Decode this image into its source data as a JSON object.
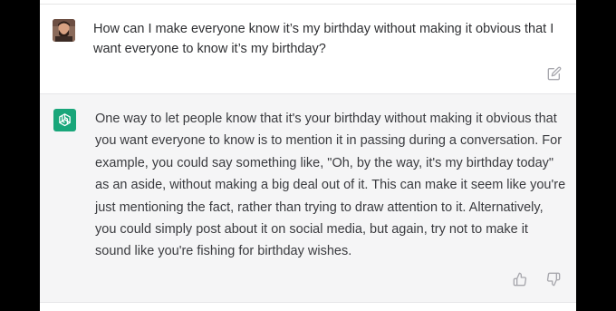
{
  "user_message": {
    "text": "How can I make everyone know it’s my birthday without making it obvious that I want everyone to know it’s my birthday?"
  },
  "assistant_message": {
    "text": "One way to let people know that it's your birthday without making it obvious that you want everyone to know is to mention it in passing during a conversation. For example, you could say something like, \"Oh, by the way, it's my birthday today\" as an aside, without making a big deal out of it. This can make it seem like you're just mentioning the fact, rather than trying to draw attention to it. Alternatively, you could simply post about it on social media, but again, try not to make it sound like you're fishing for birthday wishes."
  },
  "icons": {
    "edit": "edit-icon",
    "thumbs_up": "thumbs-up-icon",
    "thumbs_down": "thumbs-down-icon",
    "assistant_logo": "openai-logo-icon"
  },
  "colors": {
    "assistant_avatar": "#19a67a",
    "assistant_bg": "#f5f5f6",
    "page_bg": "#000000"
  }
}
